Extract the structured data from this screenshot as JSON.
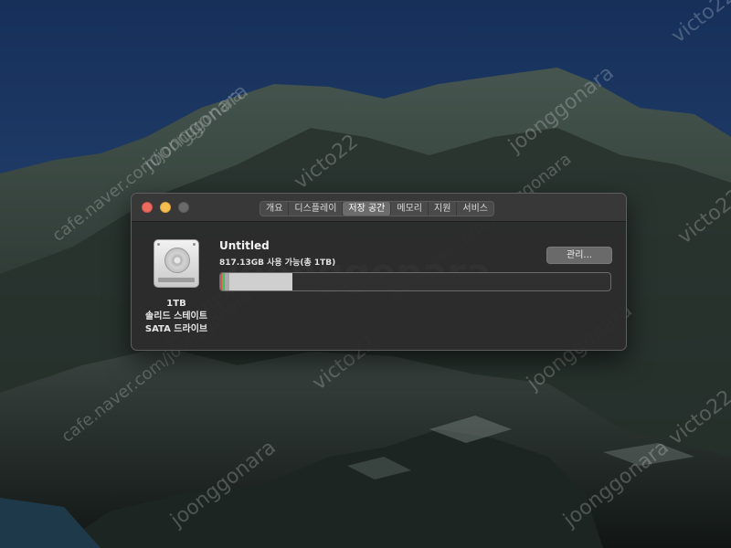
{
  "watermarks": [
    "joonggonara",
    "victo22",
    "joonggonara",
    "cafe.naver.com/joonggonara",
    "victo22",
    "joonggonara",
    "victo22",
    "cafe.naver.com/joonggonara",
    "victo22",
    "joonggonara",
    "cafe.naver.com/joonggonara",
    "victo22",
    "joonggonara",
    "joonggonara",
    "joonggonara"
  ],
  "about_window": {
    "traffic_lights": {
      "close": {
        "color": "#ed6a5e",
        "icon": "close-button"
      },
      "minimize": {
        "color": "#f5bf4f",
        "icon": "minimize-button"
      },
      "zoom": {
        "color": "#6a6a6a",
        "icon": "zoom-button-disabled"
      }
    },
    "tabs": [
      {
        "label": "개요",
        "active": false
      },
      {
        "label": "디스플레이",
        "active": false
      },
      {
        "label": "저장 공간",
        "active": true
      },
      {
        "label": "메모리",
        "active": false
      },
      {
        "label": "지원",
        "active": false
      },
      {
        "label": "서비스",
        "active": false
      }
    ],
    "disk": {
      "icon": "hard-drive-icon",
      "capacity": "1TB",
      "type_line1": "솔리드 스테이트",
      "type_line2": "SATA 드라이브"
    },
    "volume": {
      "name": "Untitled",
      "available": "817.13GB 사용 가능(총 1TB)"
    },
    "manage_button": "관리...",
    "storage_usage": {
      "segments": [
        {
          "name": "system",
          "fraction": 0.004,
          "color": "#d9534f"
        },
        {
          "name": "apps",
          "fraction": 0.008,
          "color": "#44c15a"
        },
        {
          "name": "other",
          "fraction": 0.012,
          "color": "#a9a9a9"
        },
        {
          "name": "system-data",
          "fraction": 0.16,
          "color": "#cfcfcf"
        }
      ],
      "free_fraction": 0.817
    }
  }
}
